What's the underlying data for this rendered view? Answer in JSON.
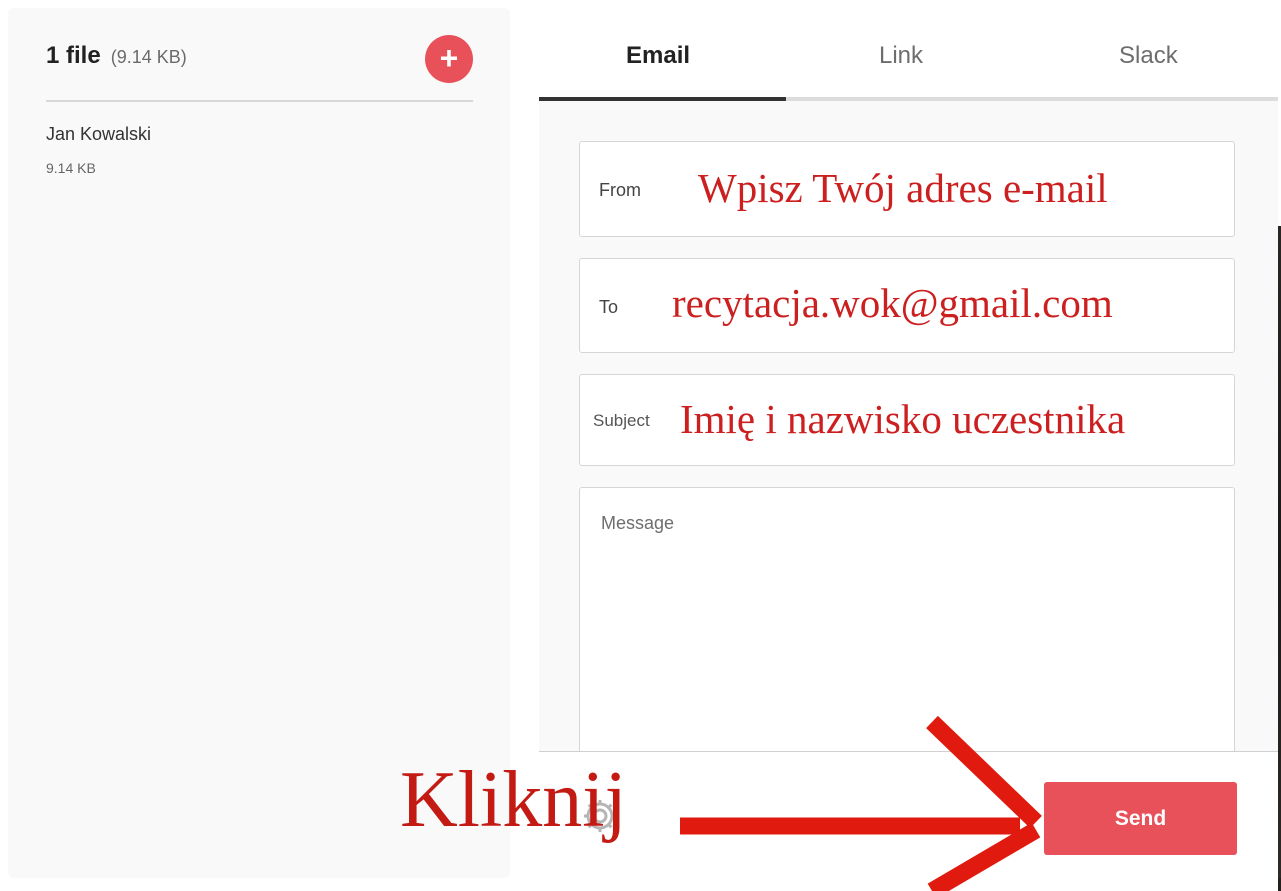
{
  "files": {
    "count_label": "1 file",
    "total_size": "(9.14 KB)",
    "add_icon": "plus-icon",
    "items": [
      {
        "name": "Jan Kowalski",
        "size": "9.14 KB"
      }
    ]
  },
  "tabs": [
    {
      "label": "Email",
      "active": true
    },
    {
      "label": "Link",
      "active": false
    },
    {
      "label": "Slack",
      "active": false
    }
  ],
  "form": {
    "from": {
      "label": "From",
      "value": "Wpisz Twój adres e-mail"
    },
    "to": {
      "label": "To",
      "value": "recytacja.wok@gmail.com"
    },
    "subject": {
      "label": "Subject",
      "value": "Imię i nazwisko uczestnika"
    },
    "message": {
      "placeholder": "Message"
    }
  },
  "footer": {
    "settings_icon": "gear-icon",
    "send_label": "Send"
  },
  "annotation": {
    "text": "Kliknij"
  },
  "colors": {
    "accent": "#e8515a",
    "annotation": "#cc1f1f",
    "panel_bg": "#f9f9f9"
  }
}
